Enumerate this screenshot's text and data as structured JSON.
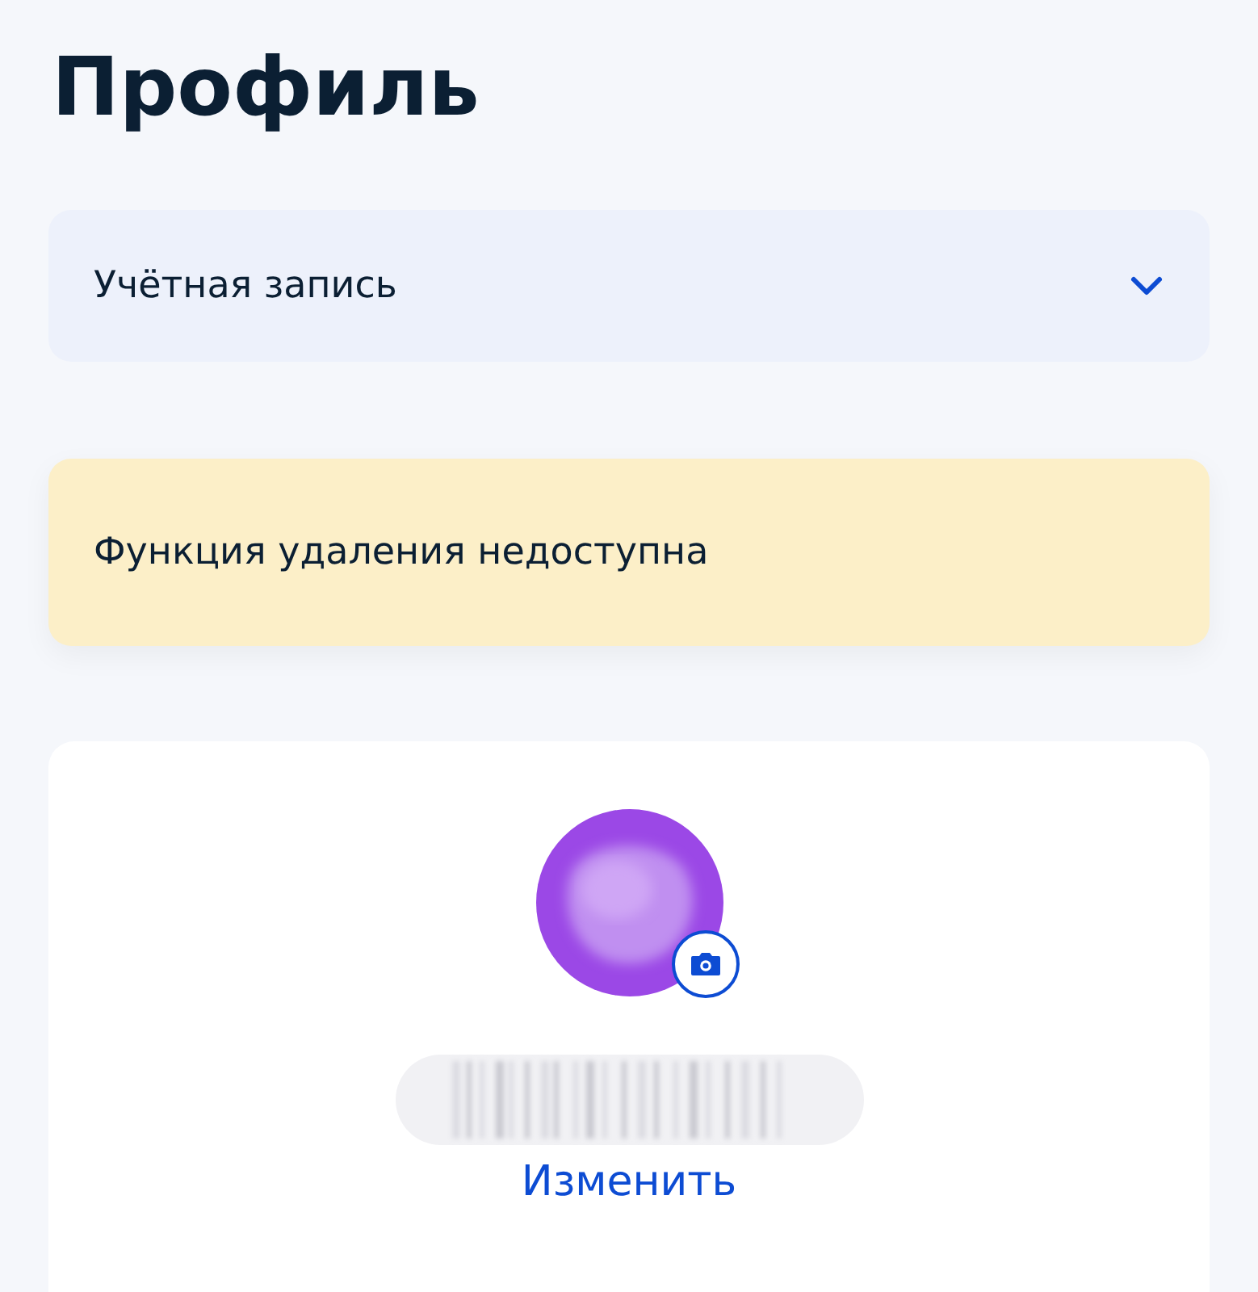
{
  "title": "Профиль",
  "account_select": {
    "label": "Учётная запись",
    "expanded": false
  },
  "alert": {
    "text": "Функция удаления недоступна"
  },
  "profile_card": {
    "edit_link": "Изменить"
  }
}
